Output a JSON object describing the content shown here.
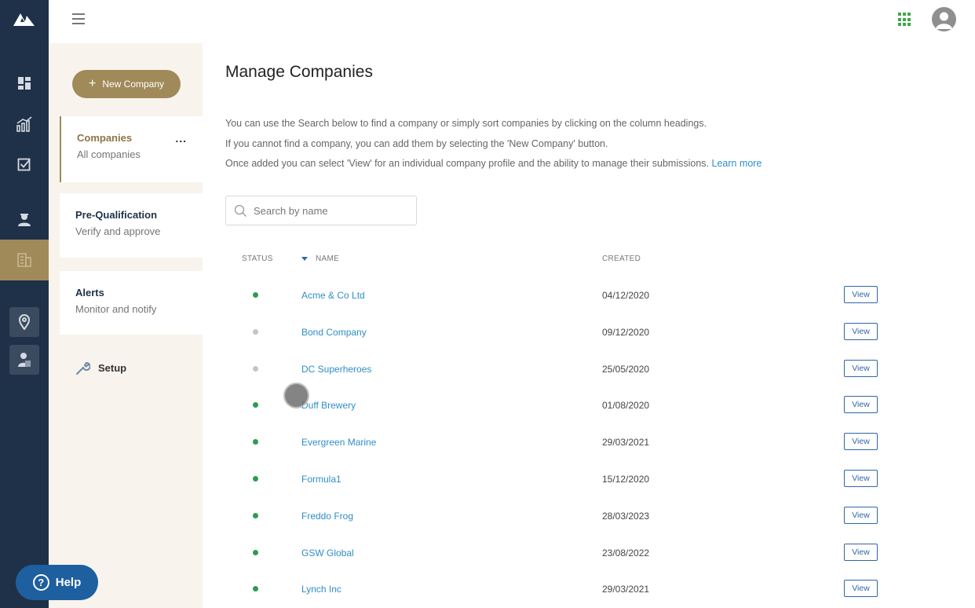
{
  "header": {
    "menu_icon": "hamburger-icon",
    "apps_icon": "grid-apps-icon",
    "user_icon": "user-avatar-icon",
    "accent_color": "#3ea84a"
  },
  "rail": {
    "items": [
      {
        "icon": "dashboard-icon"
      },
      {
        "icon": "analytics-icon"
      },
      {
        "icon": "checklist-icon"
      },
      {
        "icon": "person-icon"
      },
      {
        "icon": "building-icon",
        "active": true
      },
      {
        "icon": "location-pin-icon"
      },
      {
        "icon": "id-badge-icon"
      }
    ],
    "background": "#1e3148",
    "active_color": "#a08a5a"
  },
  "subnav": {
    "new_button": "New Company",
    "cards": [
      {
        "title": "Companies",
        "subtitle": "All companies",
        "more": "...",
        "active": true
      },
      {
        "title": "Pre-Qualification",
        "subtitle": "Verify and approve"
      },
      {
        "title": "Alerts",
        "subtitle": "Monitor and notify"
      }
    ],
    "setup": "Setup"
  },
  "main": {
    "title": "Manage Companies",
    "intro": [
      "You can use the Search below to find a company or simply sort companies by clicking on the column headings.",
      "If you cannot find a company, you can add them by selecting the 'New Company' button.",
      "Once added you can select 'View' for an individual company profile and the ability to manage their submissions."
    ],
    "learn_more": "Learn more",
    "search": {
      "placeholder": "Search by name",
      "value": ""
    },
    "columns": {
      "status": "STATUS",
      "name": "NAME",
      "created": "CREATED"
    },
    "rows": [
      {
        "status": "active",
        "name": "Acme & Co Ltd",
        "created": "04/12/2020",
        "action": "View"
      },
      {
        "status": "inactive",
        "name": "Bond Company",
        "created": "09/12/2020",
        "action": "View"
      },
      {
        "status": "inactive",
        "name": "DC Superheroes",
        "created": "25/05/2020",
        "action": "View"
      },
      {
        "status": "active",
        "name": "Duff Brewery",
        "created": "01/08/2020",
        "action": "View"
      },
      {
        "status": "active",
        "name": "Evergreen Marine",
        "created": "29/03/2021",
        "action": "View"
      },
      {
        "status": "active",
        "name": "Formula1",
        "created": "15/12/2020",
        "action": "View"
      },
      {
        "status": "active",
        "name": "Freddo Frog",
        "created": "28/03/2023",
        "action": "View"
      },
      {
        "status": "active",
        "name": "GSW Global",
        "created": "23/08/2022",
        "action": "View"
      },
      {
        "status": "active",
        "name": "Lynch Inc",
        "created": "29/03/2021",
        "action": "View"
      }
    ],
    "status_colors": {
      "active": "#2e9b4f",
      "inactive": "#c4c4c4"
    }
  },
  "help": {
    "label": "Help"
  }
}
